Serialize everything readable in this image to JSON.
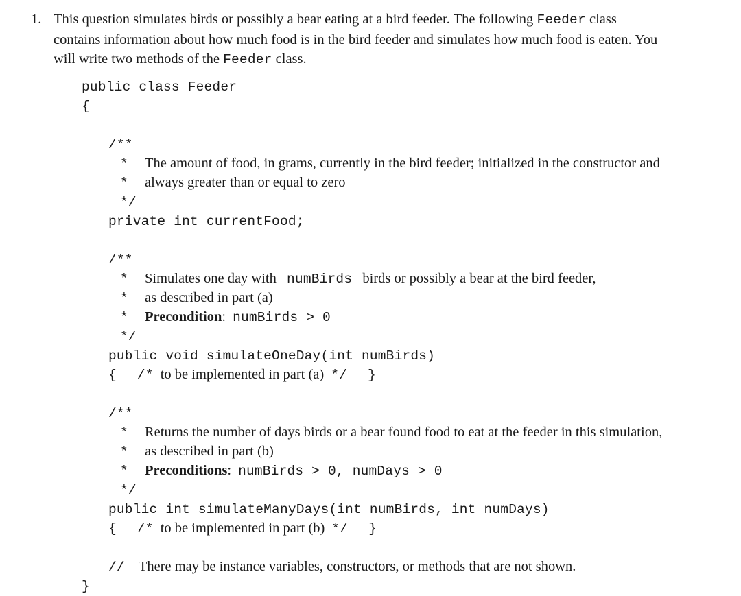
{
  "document": {
    "type": "exam-free-response-question",
    "background_color": "#ffffff",
    "text_color": "#1a1a1a"
  },
  "question": {
    "number": "1.",
    "lines": [
      {
        "parts": [
          {
            "text": "This question simulates birds or possibly a bear eating at a bird feeder.  The following ",
            "style": "serif"
          },
          {
            "text": "Feeder",
            "style": "mono"
          },
          {
            "text": " class",
            "style": "serif"
          }
        ]
      },
      {
        "parts": [
          {
            "text": "contains information about how much food is in the bird feeder and simulates how much food is eaten.  You",
            "style": "serif"
          }
        ]
      },
      {
        "parts": [
          {
            "text": "will write two methods of the ",
            "style": "serif"
          },
          {
            "text": "Feeder",
            "style": "mono"
          },
          {
            "text": " class.",
            "style": "serif"
          }
        ]
      }
    ]
  },
  "code_listing": {
    "class_declaration": "public class Feeder",
    "open_brace": "{",
    "close_brace": "}",
    "field": {
      "comment_open": "/**",
      "comment_lines": [
        "The amount of food, in grams, currently in the bird feeder; initialized in the constructor and",
        "always greater than or equal to zero"
      ],
      "comment_close": "*/",
      "declaration": "private int currentFood;"
    },
    "method_one": {
      "comment_open": "/**",
      "comment_line_1_prefix": "Simulates one day with ",
      "comment_line_1_code": "numBirds",
      "comment_line_1_suffix": " birds or possibly a bear at the bird feeder,",
      "comment_line_2": "as described in part (a)",
      "precondition_label": "Precondition",
      "precondition_colon": ":",
      "precondition_code": "numBirds > 0",
      "comment_close": "*/",
      "signature": "public void simulateOneDay(int numBirds)",
      "body_open": "{",
      "body_comment_open": "/*",
      "body_comment_text": "to be implemented in part (a)",
      "body_comment_close": "*/",
      "body_close": "}"
    },
    "method_two": {
      "comment_open": "/**",
      "comment_line_1": "Returns the number of days birds or a bear found food to eat at the feeder in this simulation,",
      "comment_line_2": "as described in part (b)",
      "precondition_label": "Preconditions",
      "precondition_colon": ":",
      "precondition_code": "numBirds > 0, numDays > 0",
      "comment_close": "*/",
      "signature": "public int simulateManyDays(int numBirds, int numDays)",
      "body_open": "{",
      "body_comment_open": "/*",
      "body_comment_text": "to be implemented in part (b)",
      "body_comment_close": "*/",
      "body_close": "}"
    },
    "trailing_note": {
      "comment_marker": "//",
      "text": "There may be instance variables, constructors, or methods that are not shown."
    }
  }
}
